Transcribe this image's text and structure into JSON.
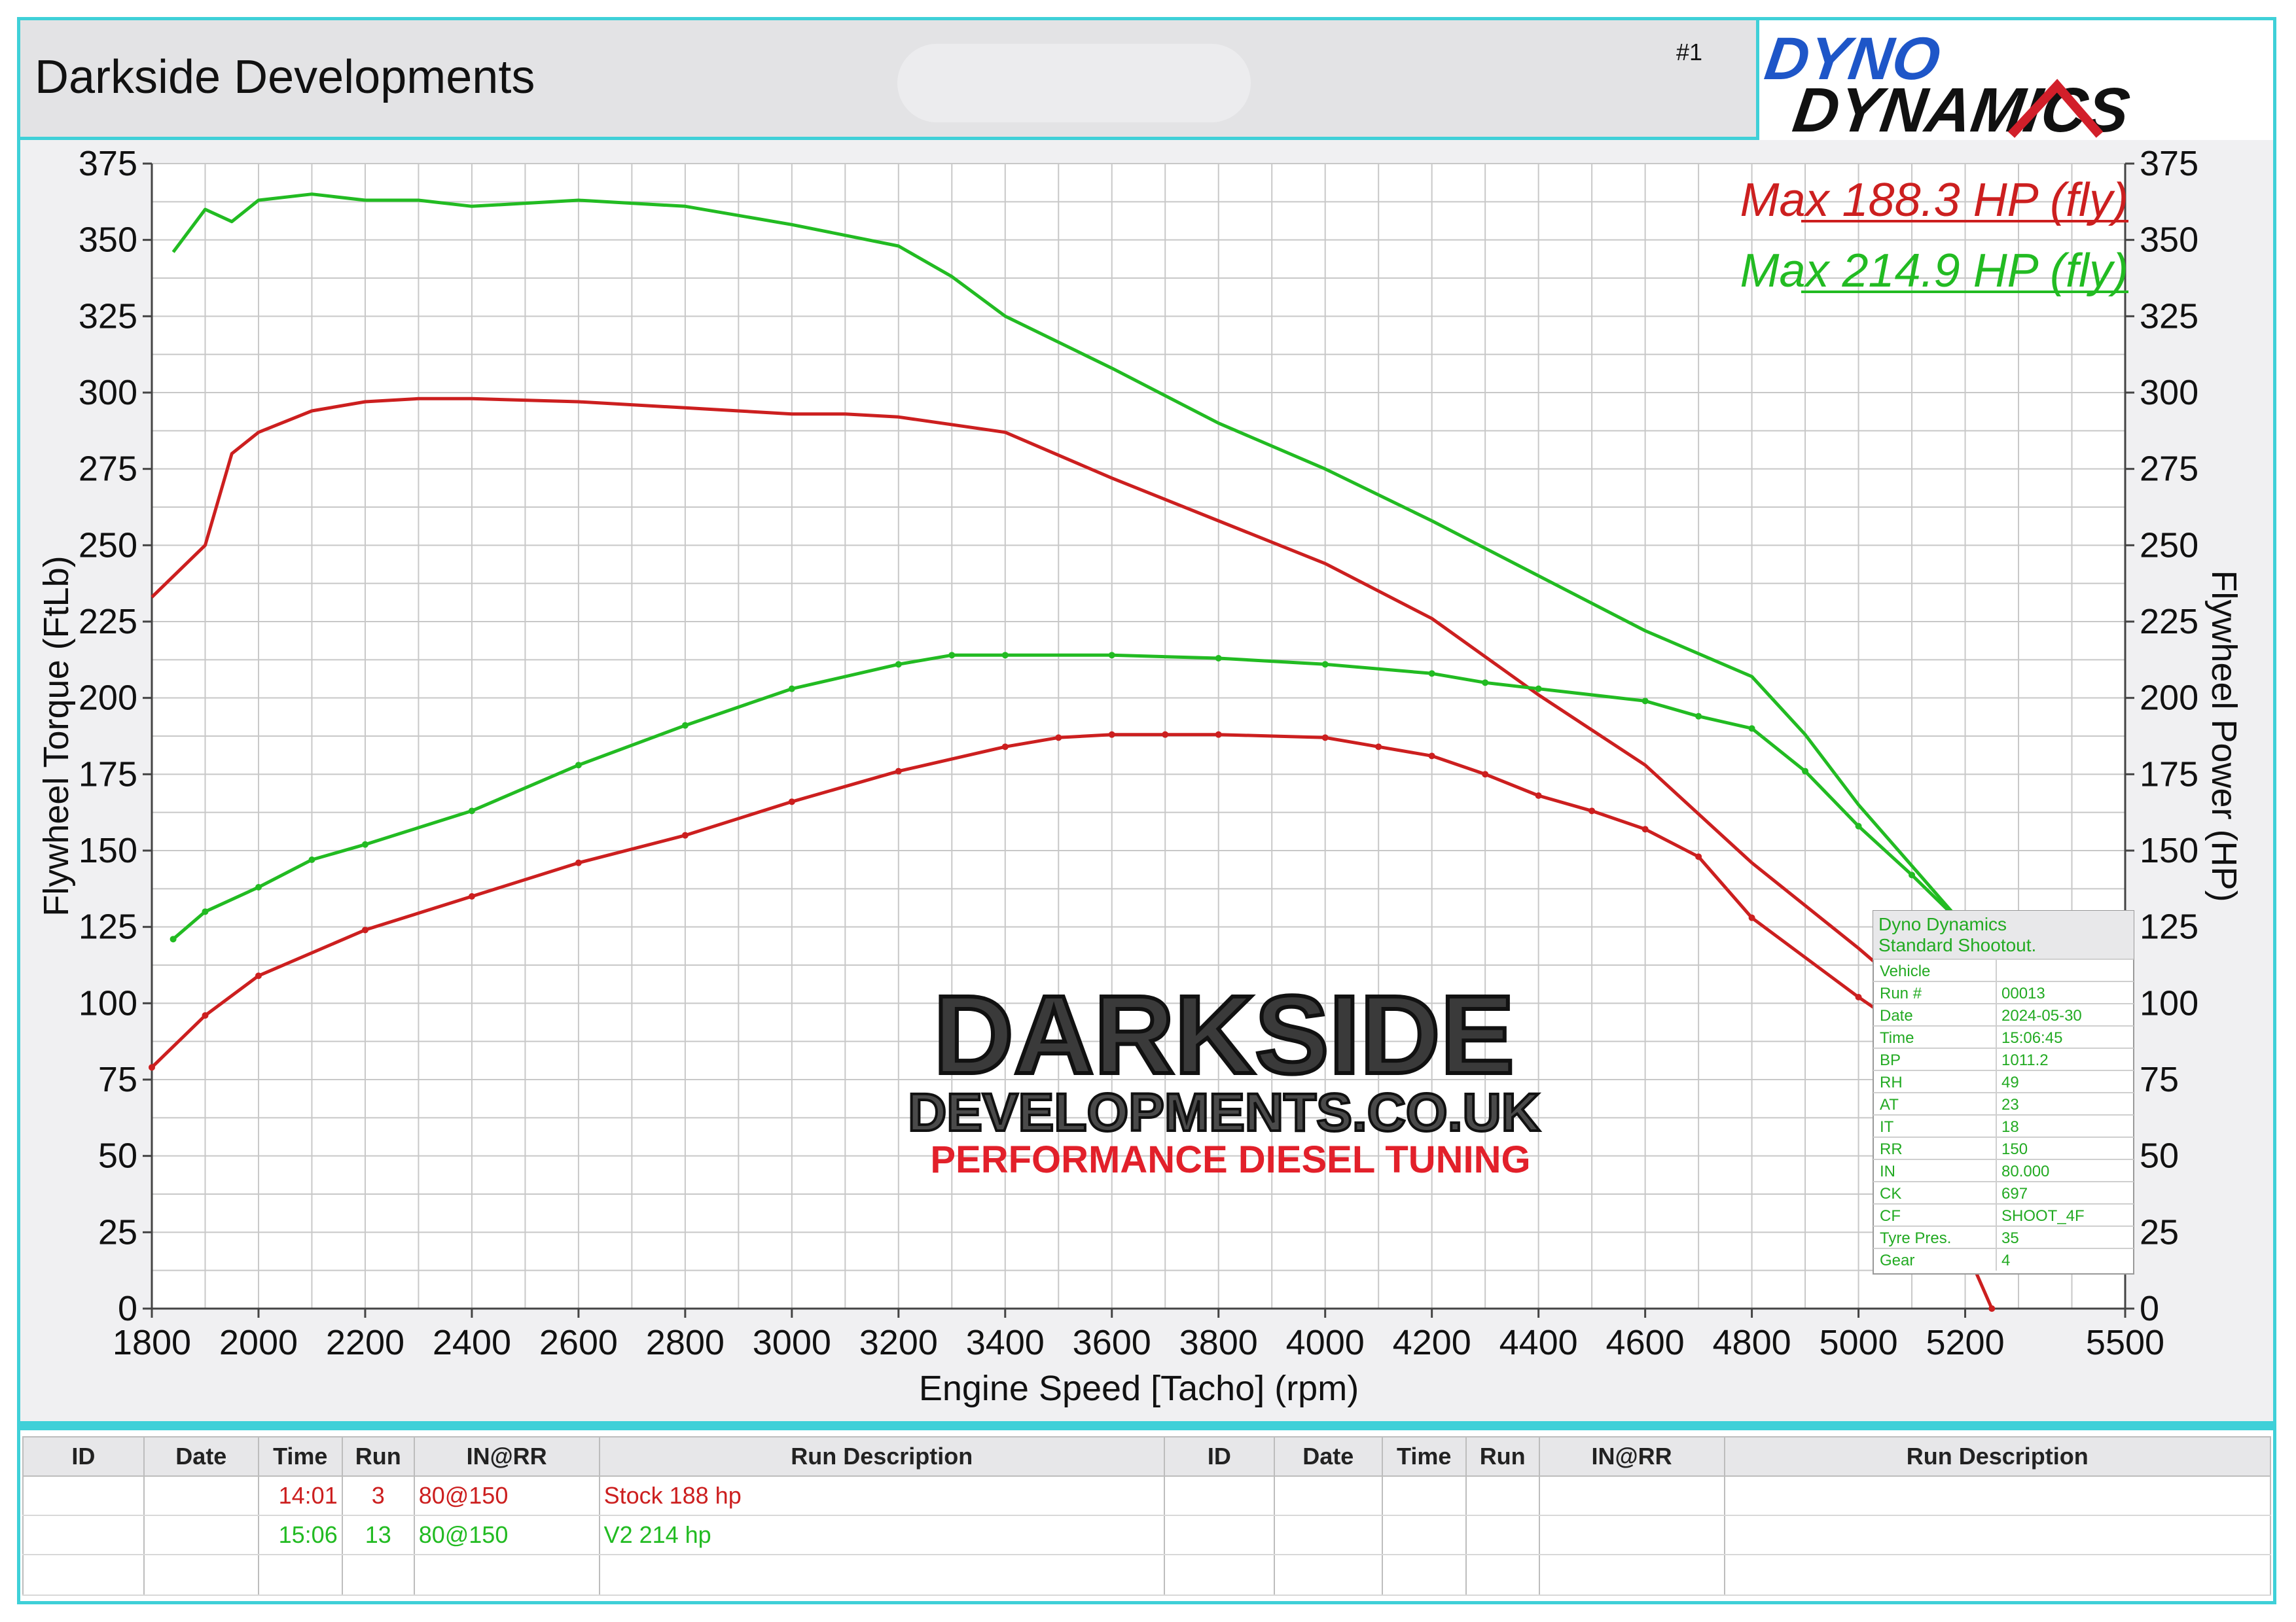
{
  "header": {
    "title": "Darkside Developments",
    "run_no": "#1",
    "logo_line1": "DYNO",
    "logo_line2": "DYNAMICS"
  },
  "watermark": {
    "line1": "DARKSIDE",
    "line2": "DEVELOPMENTS.CO.UK",
    "line3": "PERFORMANCE DIESEL TUNING"
  },
  "colors": {
    "stock": "#cc1f1f",
    "v2": "#22bb22",
    "accent": "#3fd0d8",
    "logo_blue": "#1e56c8",
    "logo_red": "#d21f2a"
  },
  "chart_data": {
    "type": "line",
    "xlabel": "Engine Speed [Tacho] (rpm)",
    "ylabel_left": "Flywheel Torque (FtLb)",
    "ylabel_right": "Flywheel Power (HP)",
    "xlim": [
      1800,
      5500
    ],
    "ylim": [
      0,
      375
    ],
    "x_ticks": [
      1800,
      2000,
      2200,
      2400,
      2600,
      2800,
      3000,
      3200,
      3400,
      3600,
      3800,
      4000,
      4200,
      4400,
      4600,
      4800,
      5000,
      5200,
      5500
    ],
    "y_ticks": [
      0,
      25,
      50,
      75,
      100,
      125,
      150,
      175,
      200,
      225,
      250,
      275,
      300,
      325,
      350,
      375
    ],
    "grid": true,
    "max_labels": [
      {
        "text": "Max 188.3 HP (fly)",
        "color": "#cc1f1f"
      },
      {
        "text": "Max 214.9 HP (fly)",
        "color": "#22bb22"
      }
    ],
    "series": [
      {
        "run": "stock",
        "color": "#cc1f1f",
        "metric": "torque",
        "x": [
          1800,
          1900,
          1950,
          2000,
          2100,
          2200,
          2300,
          2400,
          2600,
          2800,
          2900,
          3000,
          3100,
          3200,
          3400,
          3600,
          3800,
          4000,
          4200,
          4400,
          4600,
          4800,
          5000,
          5100,
          5150
        ],
        "y": [
          233,
          250,
          280,
          287,
          294,
          297,
          298,
          298,
          297,
          295,
          294,
          293,
          293,
          292,
          287,
          272,
          258,
          244,
          226,
          201,
          178,
          146,
          118,
          103,
          95
        ]
      },
      {
        "run": "stock",
        "color": "#cc1f1f",
        "metric": "power",
        "x": [
          1800,
          1900,
          2000,
          2200,
          2400,
          2600,
          2800,
          3000,
          3200,
          3400,
          3500,
          3600,
          3700,
          3800,
          4000,
          4100,
          4200,
          4300,
          4400,
          4500,
          4600,
          4700,
          4800,
          5000,
          5100,
          5200,
          5250
        ],
        "y": [
          79,
          96,
          109,
          124,
          135,
          146,
          155,
          166,
          176,
          184,
          187,
          188,
          188,
          188,
          187,
          184,
          181,
          175,
          168,
          163,
          157,
          148,
          128,
          102,
          90,
          20,
          0
        ]
      },
      {
        "run": "v2",
        "color": "#22bb22",
        "metric": "torque",
        "x": [
          1840,
          1900,
          1950,
          2000,
          2100,
          2200,
          2300,
          2400,
          2600,
          2800,
          3000,
          3200,
          3300,
          3400,
          3600,
          3800,
          4000,
          4200,
          4400,
          4600,
          4800,
          4900,
          5000,
          5100,
          5200
        ],
        "y": [
          346,
          360,
          356,
          363,
          365,
          363,
          363,
          361,
          363,
          361,
          355,
          348,
          338,
          325,
          308,
          290,
          275,
          258,
          240,
          222,
          207,
          188,
          165,
          145,
          125
        ]
      },
      {
        "run": "v2",
        "color": "#22bb22",
        "metric": "power",
        "x": [
          1840,
          1900,
          2000,
          2100,
          2200,
          2400,
          2600,
          2800,
          3000,
          3200,
          3300,
          3400,
          3600,
          3800,
          4000,
          4200,
          4300,
          4400,
          4600,
          4700,
          4800,
          4900,
          5000,
          5100,
          5200
        ],
        "y": [
          121,
          130,
          138,
          147,
          152,
          163,
          178,
          191,
          203,
          211,
          214,
          214,
          214,
          213,
          211,
          208,
          205,
          203,
          199,
          194,
          190,
          176,
          158,
          142,
          125
        ]
      }
    ]
  },
  "info_box": {
    "title1": "Dyno Dynamics",
    "title2": "Standard Shootout.",
    "rows": [
      {
        "k": "Vehicle",
        "v": ""
      },
      {
        "k": "Run #",
        "v": "00013"
      },
      {
        "k": "Date",
        "v": "2024-05-30"
      },
      {
        "k": "Time",
        "v": "15:06:45"
      },
      {
        "k": "BP",
        "v": "1011.2"
      },
      {
        "k": "RH",
        "v": "49"
      },
      {
        "k": "AT",
        "v": "23"
      },
      {
        "k": "IT",
        "v": "18"
      },
      {
        "k": "RR",
        "v": "150"
      },
      {
        "k": "IN",
        "v": "80.000"
      },
      {
        "k": "CK",
        "v": "697"
      },
      {
        "k": "CF",
        "v": "SHOOT_4F"
      },
      {
        "k": "Tyre Pres.",
        "v": "35"
      },
      {
        "k": "Gear",
        "v": "4"
      }
    ]
  },
  "run_table": {
    "headers": [
      "ID",
      "Date",
      "Time",
      "Run",
      "IN@RR",
      "Run Description",
      "ID",
      "Date",
      "Time",
      "Run",
      "IN@RR",
      "Run Description"
    ],
    "rows": [
      {
        "time": "14:01",
        "run": "3",
        "inrr": "80@150",
        "desc": "Stock 188 hp",
        "color": "#cc1f1f"
      },
      {
        "time": "15:06",
        "run": "13",
        "inrr": "80@150",
        "desc": "V2 214 hp",
        "color": "#22bb22"
      }
    ]
  }
}
